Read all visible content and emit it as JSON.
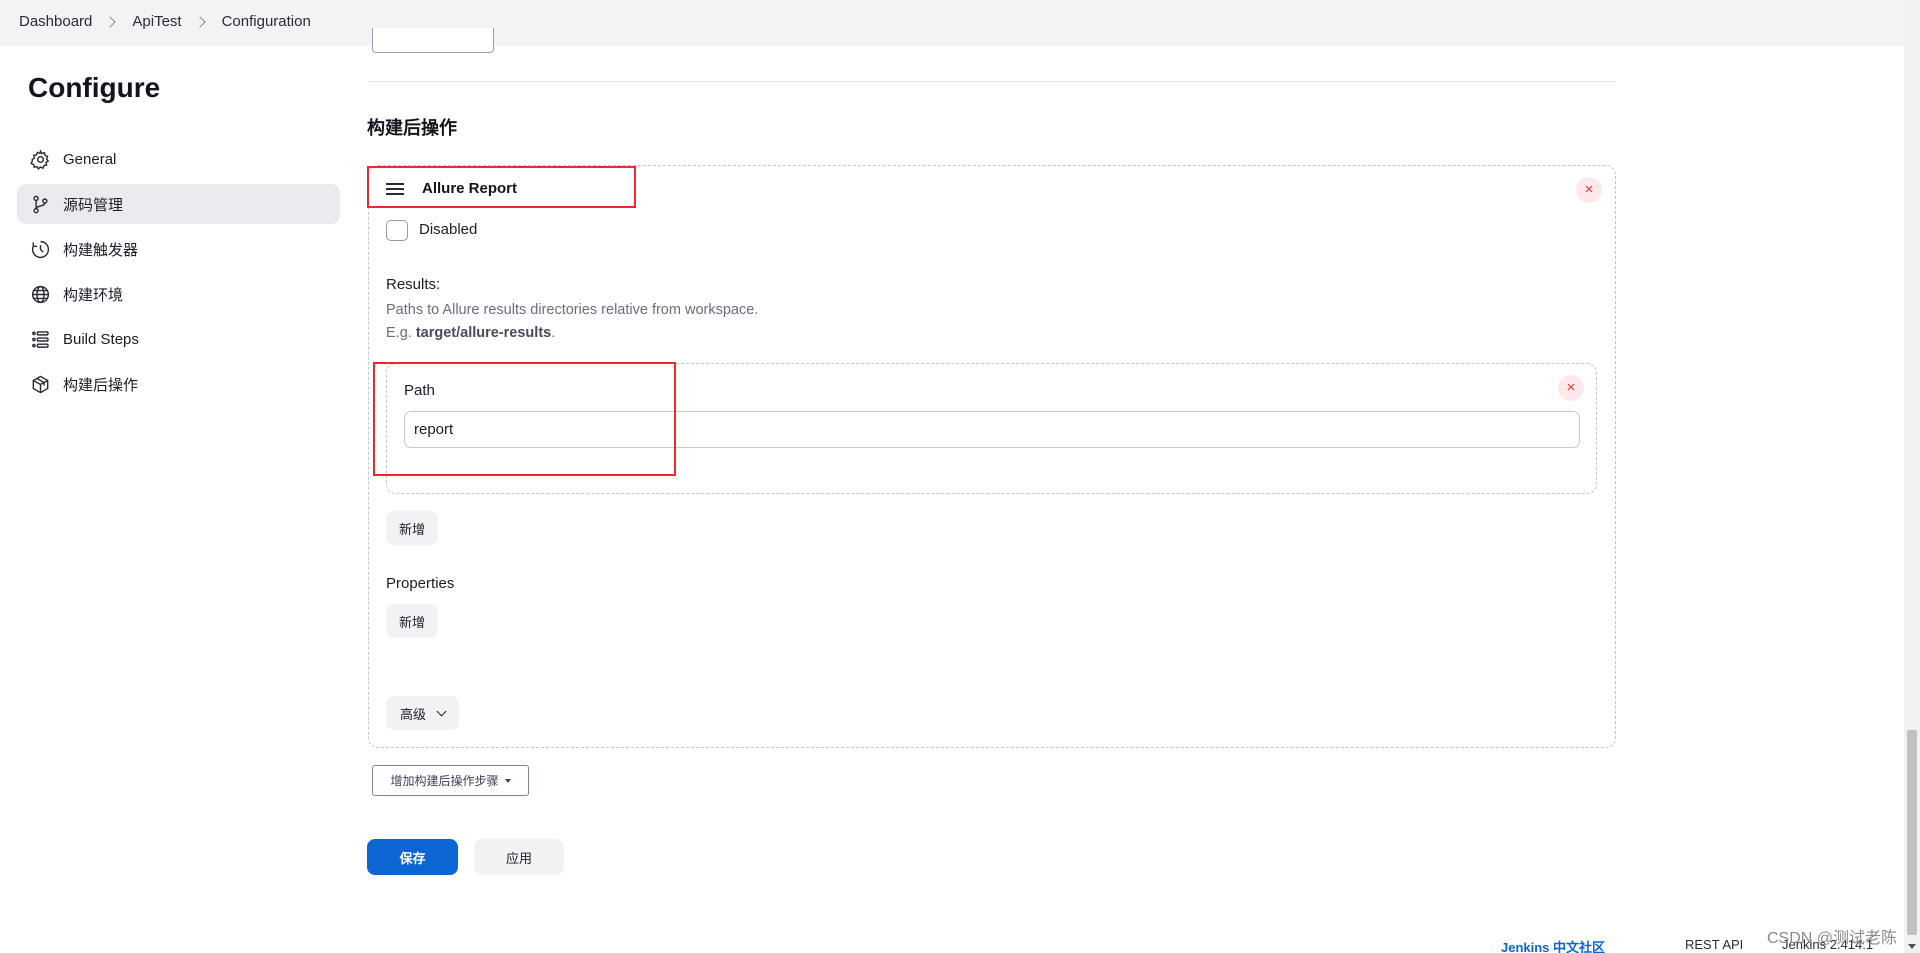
{
  "breadcrumb": [
    "Dashboard",
    "ApiTest",
    "Configuration"
  ],
  "sidebar": {
    "title": "Configure",
    "items": [
      {
        "label": "General",
        "icon": "gear-icon",
        "active": false
      },
      {
        "label": "源码管理",
        "icon": "branch-icon",
        "active": true
      },
      {
        "label": "构建触发器",
        "icon": "clock-icon",
        "active": false
      },
      {
        "label": "构建环境",
        "icon": "globe-icon",
        "active": false
      },
      {
        "label": "Build Steps",
        "icon": "list-icon",
        "active": false
      },
      {
        "label": "构建后操作",
        "icon": "package-icon",
        "active": false
      }
    ]
  },
  "main": {
    "section_title": "构建后操作",
    "step": {
      "title": "Allure Report",
      "disabled_label": "Disabled",
      "results_label": "Results:",
      "help_line1": "Paths to Allure results directories relative from workspace.",
      "help_line2_prefix": "E.g. ",
      "help_line2_example": "target/allure-results",
      "help_line2_suffix": ".",
      "path_label": "Path",
      "path_value": "report",
      "add_button_1": "新增",
      "properties_label": "Properties",
      "add_button_2": "新增",
      "advanced_button": "高级",
      "close_symbol": "×"
    },
    "add_step_button": "增加构建后操作步骤",
    "save_button": "保存",
    "apply_button": "应用"
  },
  "footer": {
    "community_link": "Jenkins 中文社区",
    "rest_api": "REST API",
    "version": "Jenkins 2.414.1"
  },
  "watermark": "CSDN @测试老陈",
  "colors": {
    "primary": "#0b66d4",
    "annotation": "#f0282e",
    "close": "#e0353b"
  }
}
